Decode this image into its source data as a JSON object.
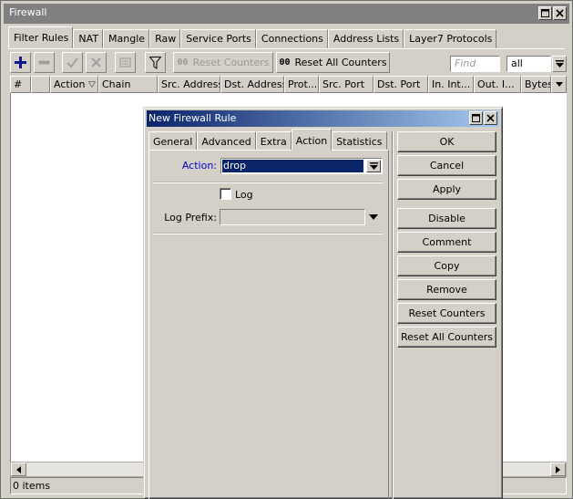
{
  "window": {
    "title": "Firewall",
    "title_buttons": {
      "restore_icon": "restore-icon",
      "close_icon": "close-icon"
    }
  },
  "tabs": [
    "Filter Rules",
    "NAT",
    "Mangle",
    "Raw",
    "Service Ports",
    "Connections",
    "Address Lists",
    "Layer7 Protocols"
  ],
  "toolbar": {
    "add_icon": "plus-icon",
    "remove_icon": "minus-icon",
    "enable_icon": "check-icon",
    "disable_icon": "x-icon",
    "comment_icon": "note-icon",
    "filter_icon": "funnel-icon",
    "counter_prefix": "00",
    "reset_counters_label": "Reset Counters",
    "reset_all_counters_label": "Reset All Counters",
    "find_placeholder": "Find",
    "scope_value": "all"
  },
  "grid": {
    "columns": [
      "#",
      "",
      "Action",
      "Chain",
      "Src. Address",
      "Dst. Address",
      "Prot...",
      "Src. Port",
      "Dst. Port",
      "In. Int...",
      "Out. I...",
      "Bytes"
    ]
  },
  "status": {
    "items": "0 items"
  },
  "dialog": {
    "title": "New Firewall Rule",
    "tabs": [
      "General",
      "Advanced",
      "Extra",
      "Action",
      "Statistics"
    ],
    "active_tab": "Action",
    "action_label": "Action:",
    "action_value": "drop",
    "log_label": "Log",
    "log_checked": false,
    "log_prefix_label": "Log Prefix:",
    "log_prefix_value": "",
    "buttons": [
      "OK",
      "Cancel",
      "Apply",
      "Disable",
      "Comment",
      "Copy",
      "Remove",
      "Reset Counters",
      "Reset All Counters"
    ],
    "label_color": "#0000c8"
  }
}
